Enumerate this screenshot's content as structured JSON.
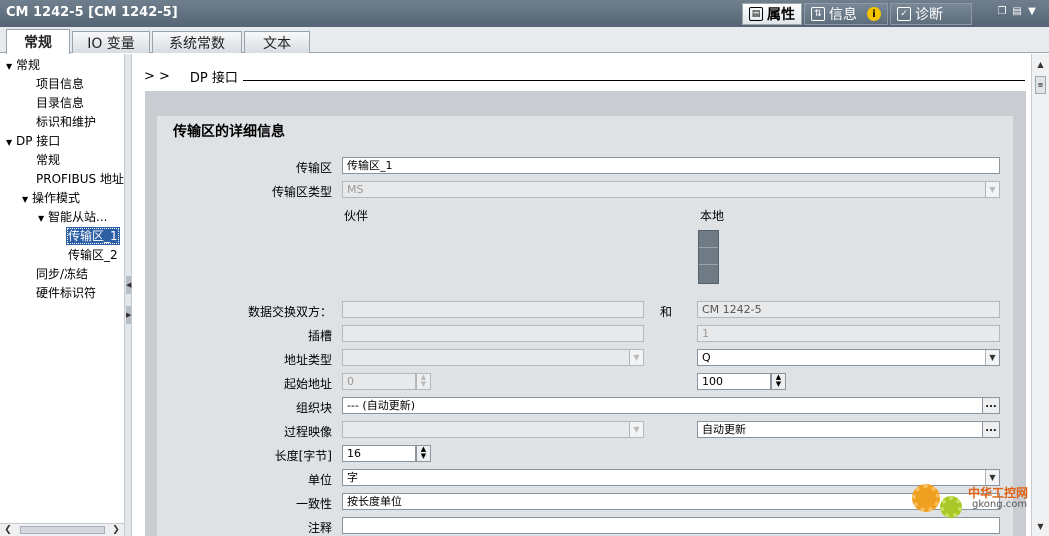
{
  "window": {
    "title": "CM 1242-5 [CM 1242-5]",
    "panel_tabs": [
      {
        "label": "属性",
        "icon": "properties-icon"
      },
      {
        "label": "信息",
        "icon": "info-icon",
        "badge": "i"
      },
      {
        "label": "诊断",
        "icon": "diagnostics-icon"
      }
    ]
  },
  "tabs": [
    {
      "label": "常规"
    },
    {
      "label": "IO 变量"
    },
    {
      "label": "系统常数"
    },
    {
      "label": "文本"
    }
  ],
  "tree": {
    "items": [
      {
        "label": "常规"
      },
      {
        "label": "项目信息"
      },
      {
        "label": "目录信息"
      },
      {
        "label": "标识和维护"
      },
      {
        "label": "DP 接口"
      },
      {
        "label": "常规"
      },
      {
        "label": "PROFIBUS 地址"
      },
      {
        "label": "操作模式"
      },
      {
        "label": "智能从站..."
      },
      {
        "label": "传输区_1"
      },
      {
        "label": "传输区_2"
      },
      {
        "label": "同步/冻结"
      },
      {
        "label": "硬件标识符"
      }
    ]
  },
  "breadcrumb": {
    "sep": "> >",
    "label": "DP 接口"
  },
  "section": {
    "title": "传输区的详细信息",
    "transfer_area_label": "传输区",
    "transfer_area_value": "传输区_1",
    "transfer_type_label": "传输区类型",
    "transfer_type_value": "MS",
    "partner_header": "伙伴",
    "local_header": "本地",
    "exchange_label": "数据交换双方：",
    "and_label": "和",
    "partner_exchange_value": "",
    "local_exchange_value": "CM 1242-5",
    "slot_label": "插槽",
    "partner_slot_value": "",
    "local_slot_value": "1",
    "addr_type_label": "地址类型",
    "partner_addr_type_value": "",
    "local_addr_type_value": "Q",
    "start_addr_label": "起始地址",
    "partner_start_addr_value": "0",
    "local_start_addr_value": "100",
    "ob_label": "组织块",
    "ob_value": "--- (自动更新)",
    "pi_label": "过程映像",
    "partner_pi_value": "",
    "local_pi_value": "自动更新",
    "length_label": "长度[字节]",
    "length_value": "16",
    "unit_label": "单位",
    "unit_value": "字",
    "consistency_label": "一致性",
    "consistency_value": "按长度单位",
    "comment_label": "注释",
    "comment_value": ""
  },
  "watermark": {
    "line1": "中华工控网",
    "line2": "gkong.com"
  }
}
